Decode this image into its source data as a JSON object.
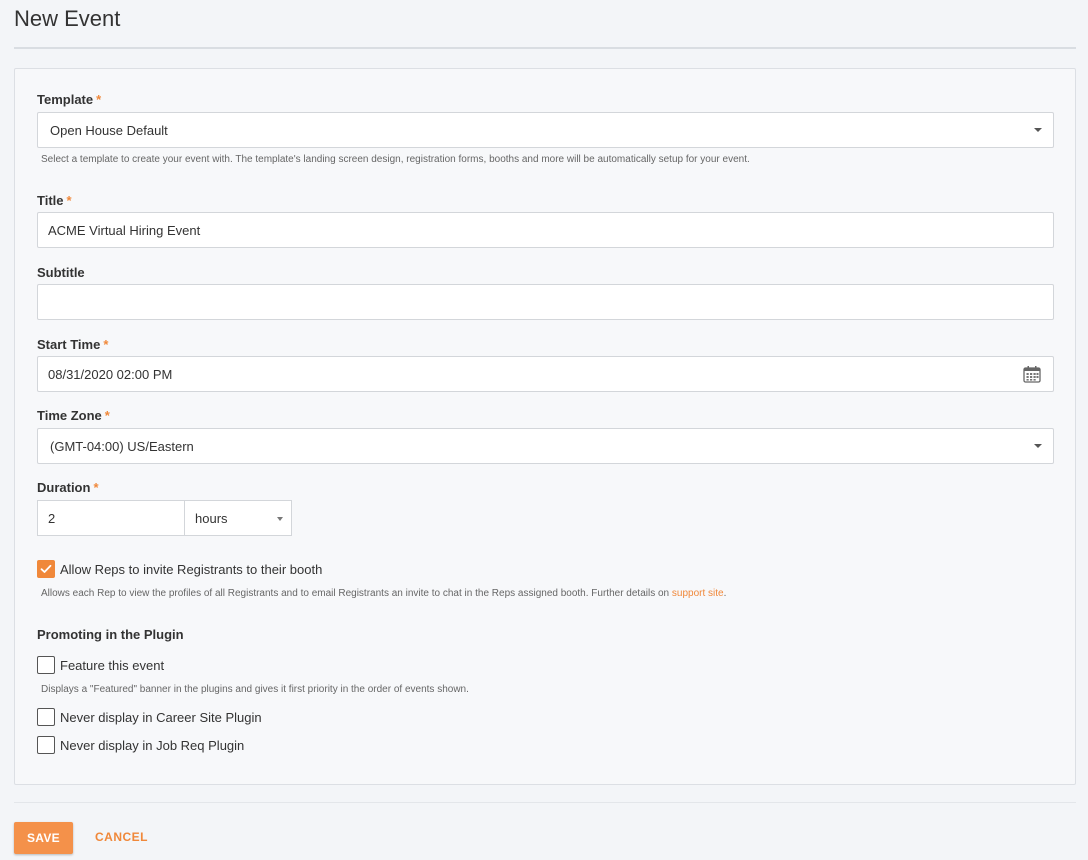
{
  "page": {
    "title": "New Event"
  },
  "form": {
    "template": {
      "label": "Template",
      "required_mark": "*",
      "value": "Open House Default",
      "help": "Select a template to create your event with. The template's landing screen design, registration forms, booths and more will be automatically setup for your event."
    },
    "title": {
      "label": "Title",
      "required_mark": "*",
      "value": "ACME Virtual Hiring Event"
    },
    "subtitle": {
      "label": "Subtitle",
      "value": ""
    },
    "start_time": {
      "label": "Start Time",
      "required_mark": "*",
      "value": "08/31/2020 02:00 PM",
      "icon": "calendar-icon"
    },
    "time_zone": {
      "label": "Time Zone",
      "required_mark": "*",
      "value": "(GMT-04:00) US/Eastern"
    },
    "duration": {
      "label": "Duration",
      "required_mark": "*",
      "value": "2",
      "unit": "hours"
    },
    "allow_reps": {
      "label": "Allow Reps to invite Registrants to their booth",
      "checked": true,
      "help": "Allows each Rep to view the profiles of all Registrants and to email Registrants an invite to chat in the Reps assigned booth. Further details on ",
      "link": "support site",
      "help_end": "."
    },
    "promoting": {
      "heading": "Promoting in the Plugin",
      "feature": {
        "label": "Feature this event",
        "checked": false,
        "help": "Displays a \"Featured\" banner in the plugins and gives it first priority in the order of events shown."
      },
      "never_career": {
        "label": "Never display in Career Site Plugin",
        "checked": false
      },
      "never_jobreq": {
        "label": "Never display in Job Req Plugin",
        "checked": false
      }
    }
  },
  "actions": {
    "save": "SAVE",
    "cancel": "CANCEL"
  },
  "colors": {
    "accent": "#f0883a",
    "background": "#f3f5f8"
  }
}
